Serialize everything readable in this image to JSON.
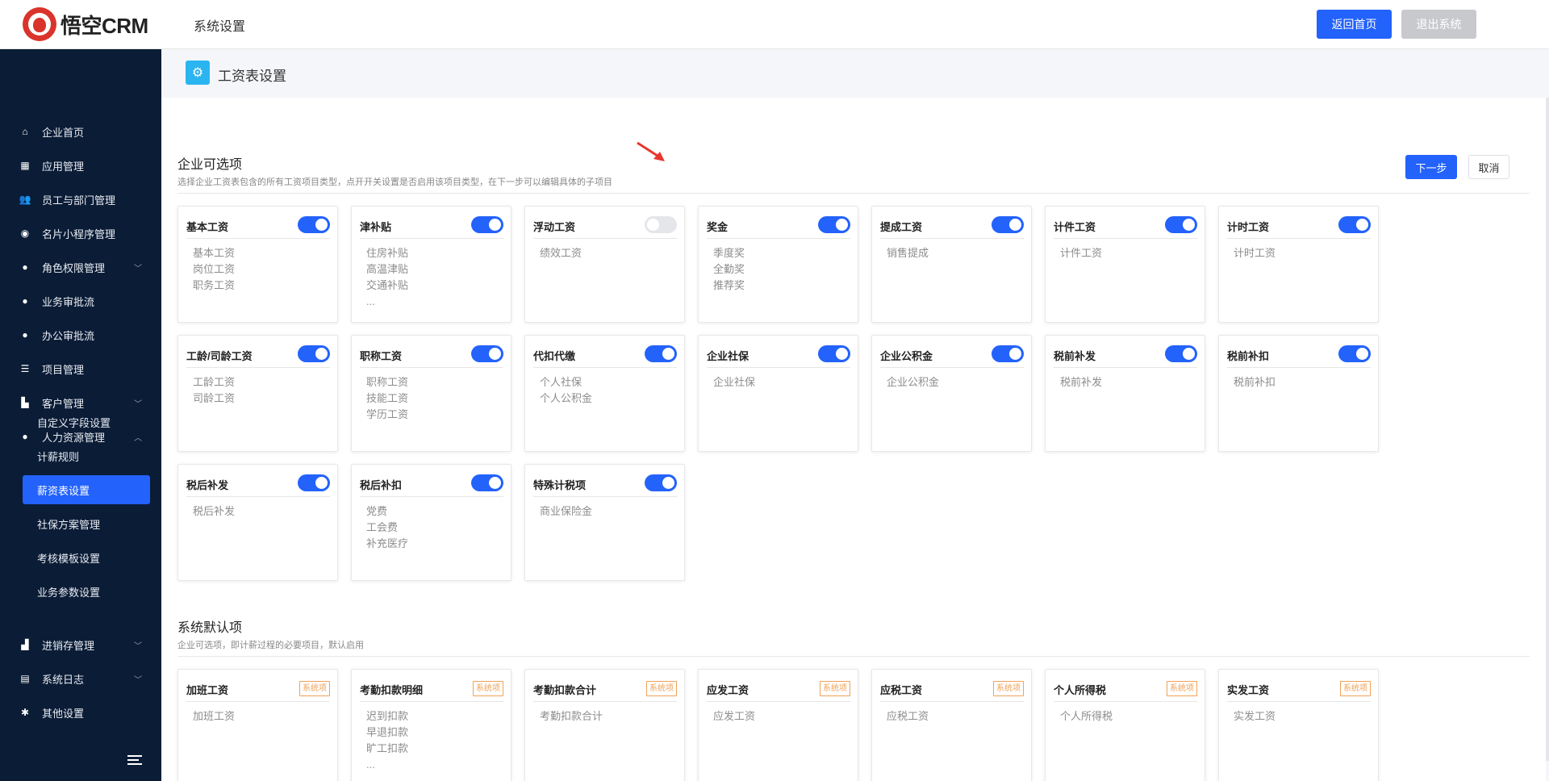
{
  "header": {
    "logo_text": "悟空CRM",
    "title": "系统设置",
    "home_button": "返回首页",
    "exit_button": "退出系统"
  },
  "sidebar": {
    "items": [
      {
        "label": "企业首页",
        "icon": "home-icon",
        "glyph": "⌂"
      },
      {
        "label": "应用管理",
        "icon": "grid-icon",
        "glyph": "▦"
      },
      {
        "label": "员工与部门管理",
        "icon": "users-icon",
        "glyph": "👥"
      },
      {
        "label": "名片小程序管理",
        "icon": "miniapp-icon",
        "glyph": "◉"
      },
      {
        "label": "角色权限管理",
        "icon": "user-icon",
        "glyph": "●",
        "expand": "﹀"
      },
      {
        "label": "业务审批流",
        "icon": "user-icon",
        "glyph": "●"
      },
      {
        "label": "办公审批流",
        "icon": "user-icon",
        "glyph": "●"
      },
      {
        "label": "项目管理",
        "icon": "list-icon",
        "glyph": "☰"
      },
      {
        "label": "客户管理",
        "icon": "building-icon",
        "glyph": "▙",
        "expand": "﹀"
      },
      {
        "label": "人力资源管理",
        "icon": "users-icon",
        "glyph": "●",
        "expand": "︿"
      }
    ],
    "sub_items": [
      "自定义字段设置",
      "计薪规则",
      "薪资表设置",
      "社保方案管理",
      "考核模板设置",
      "业务参数设置"
    ],
    "items_after": [
      {
        "label": "进销存管理",
        "icon": "chart-icon",
        "glyph": "▟",
        "expand": "﹀"
      },
      {
        "label": "系统日志",
        "icon": "log-icon",
        "glyph": "▤",
        "expand": "﹀"
      },
      {
        "label": "其他设置",
        "icon": "gear-icon",
        "glyph": "✱"
      }
    ]
  },
  "page": {
    "title": "工资表设置",
    "next_button": "下一步",
    "cancel_button": "取消"
  },
  "optional_section": {
    "title": "企业可选项",
    "desc": "选择企业工资表包含的所有工资项目类型，点开开关设置是否启用该项目类型，在下一步可以编辑具体的子项目",
    "cards": [
      {
        "title": "基本工资",
        "enabled": true,
        "items": [
          "基本工资",
          "岗位工资",
          "职务工资"
        ]
      },
      {
        "title": "津补贴",
        "enabled": true,
        "items": [
          "住房补贴",
          "高温津贴",
          "交通补贴",
          "..."
        ]
      },
      {
        "title": "浮动工资",
        "enabled": false,
        "items": [
          "绩效工资"
        ]
      },
      {
        "title": "奖金",
        "enabled": true,
        "items": [
          "季度奖",
          "全勤奖",
          "推荐奖"
        ]
      },
      {
        "title": "提成工资",
        "enabled": true,
        "items": [
          "销售提成"
        ]
      },
      {
        "title": "计件工资",
        "enabled": true,
        "items": [
          "计件工资"
        ]
      },
      {
        "title": "计时工资",
        "enabled": true,
        "items": [
          "计时工资"
        ]
      },
      {
        "title": "工龄/司龄工资",
        "enabled": true,
        "items": [
          "工龄工资",
          "司龄工资"
        ]
      },
      {
        "title": "职称工资",
        "enabled": true,
        "items": [
          "职称工资",
          "技能工资",
          "学历工资"
        ]
      },
      {
        "title": "代扣代缴",
        "enabled": true,
        "items": [
          "个人社保",
          "个人公积金"
        ]
      },
      {
        "title": "企业社保",
        "enabled": true,
        "items": [
          "企业社保"
        ]
      },
      {
        "title": "企业公积金",
        "enabled": true,
        "items": [
          "企业公积金"
        ]
      },
      {
        "title": "税前补发",
        "enabled": true,
        "items": [
          "税前补发"
        ]
      },
      {
        "title": "税前补扣",
        "enabled": true,
        "items": [
          "税前补扣"
        ]
      },
      {
        "title": "税后补发",
        "enabled": true,
        "items": [
          "税后补发"
        ]
      },
      {
        "title": "税后补扣",
        "enabled": true,
        "items": [
          "党费",
          "工会费",
          "补充医疗"
        ]
      },
      {
        "title": "特殊计税项",
        "enabled": true,
        "items": [
          "商业保险金"
        ]
      }
    ]
  },
  "default_section": {
    "title": "系统默认项",
    "desc": "企业可选项，即计薪过程的必要项目，默认启用",
    "badge": "系统项",
    "cards": [
      {
        "title": "加班工资",
        "items": [
          "加班工资"
        ]
      },
      {
        "title": "考勤扣款明细",
        "items": [
          "迟到扣款",
          "早退扣款",
          "旷工扣款",
          "..."
        ]
      },
      {
        "title": "考勤扣款合计",
        "items": [
          "考勤扣款合计"
        ]
      },
      {
        "title": "应发工资",
        "items": [
          "应发工资"
        ]
      },
      {
        "title": "应税工资",
        "items": [
          "应税工资"
        ]
      },
      {
        "title": "个人所得税",
        "items": [
          "个人所得税"
        ]
      },
      {
        "title": "实发工资",
        "items": [
          "实发工资"
        ]
      }
    ]
  },
  "colors": {
    "primary": "#2362fb",
    "sidebar_bg": "#0b1c36",
    "badge": "#f0a257",
    "arrow": "#e8372d"
  }
}
